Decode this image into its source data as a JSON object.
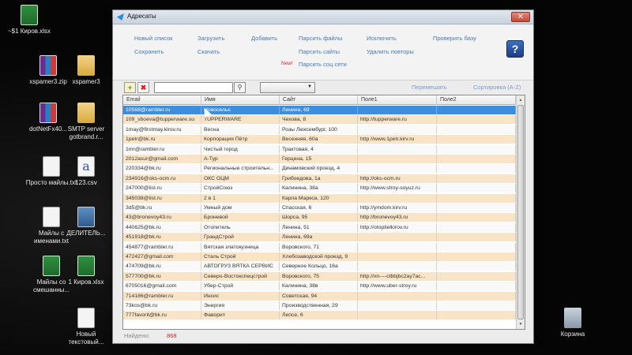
{
  "desktop": {
    "icons": [
      {
        "label": "~$1 Киров.xlsx",
        "icon": "excel-file-icon"
      },
      {
        "label": "xspamer3.zip",
        "icon": "winrar-archive-icon"
      },
      {
        "label": "xspamer3",
        "icon": "folder-icon"
      },
      {
        "label": "dotNetFx40...",
        "icon": "winrar-archive-icon"
      },
      {
        "label": "SMTP server gotbrand.r...",
        "icon": "folder-icon"
      },
      {
        "label": "Просто майлы.txt",
        "icon": "text-file-icon"
      },
      {
        "label": "123.csv",
        "icon": "csv-file-icon"
      },
      {
        "label": "Майлы с именами.txt",
        "icon": "text-file-icon"
      },
      {
        "label": "ДЕЛИТЕЛЬ...",
        "icon": "image-file-icon"
      },
      {
        "label": "Майлы со смешанны...",
        "icon": "excel-file-icon"
      },
      {
        "label": "1 Киров.xlsx",
        "icon": "excel-file-icon"
      },
      {
        "label": "Новый текстовый...",
        "icon": "text-file-icon"
      },
      {
        "label": "Корзина",
        "icon": "recycle-bin-icon"
      }
    ]
  },
  "window": {
    "title": "Адресаты",
    "close_glyph": "✕",
    "help_glyph": "?"
  },
  "toolbar": {
    "new_list": "Новый список",
    "save": "Сохранить",
    "load": "Загрузить",
    "download": "Скачать",
    "add": "Добавить",
    "parse_files": "Парсить файлы",
    "parse_sites": "Парсить сайты",
    "new_badge": "New!",
    "parse_social": "Парсить соц сети",
    "exclude": "Исключить",
    "remove_duplicates": "Удалить повторы",
    "check_base": "Проверить  базу"
  },
  "filterbar": {
    "add_glyph": "+",
    "delete_glyph": "✖",
    "search_value": "",
    "search_glyph": "⚲",
    "combo_value": "",
    "shuffle": "Перемешать",
    "sort": "Сортировка (A-Z)"
  },
  "grid": {
    "columns": [
      "Email",
      "Имя",
      "Сайт",
      "Поле1",
      "Поле2"
    ],
    "selected_row": 0,
    "rows": [
      [
        "10568@rambler.ru",
        "Новосельє",
        "Ленина, 69",
        "",
        ""
      ],
      [
        "109_sboeva@tupperware.su",
        "TUPPERWARE",
        "Чехова, 8",
        "http://tupperware.ru",
        ""
      ],
      [
        "1may@firstmay.kirov.ru",
        "Весна",
        "Розы Люксембург, 100",
        "",
        ""
      ],
      [
        "1petr@bk.ru",
        "Корпорация Пётр",
        "Весенняя, 60а",
        "http://www.1petr.kirv.ru",
        ""
      ],
      [
        "1mr@rambler.ru",
        "Чистый город",
        "Трактовая, 4",
        "",
        ""
      ],
      [
        "2012asur@gmail.com",
        "А-Тур",
        "Герцена, 15",
        "",
        ""
      ],
      [
        "220334@bk.ru",
        "Региональные строительн...",
        "Динамовский проезд, 4",
        "",
        ""
      ],
      [
        "234916@oks-ocm.ru",
        "ОКС ОЦМ",
        "Грибоедова, 1а",
        "http://oks-ocm.ru",
        ""
      ],
      [
        "247000@list.ru",
        "СтройСоюз",
        "Калинина, 38а",
        "http://www.stroy-soyuz.ru",
        ""
      ],
      [
        "345038@list.ru",
        "2 в 1",
        "Карла Маркса, 120",
        "",
        ""
      ],
      [
        "3d5@bk.ru",
        "Умный дом",
        "Спасская, 6",
        "http://ymdom.kirv.ru",
        ""
      ],
      [
        "43@bronevoy43.ru",
        "Броневой",
        "Шорса, 95",
        "http://bronevoy43.ru",
        ""
      ],
      [
        "440625@bk.ru",
        "Отопитель",
        "Ленина, 51",
        "http://otopitelkirov.ru",
        ""
      ],
      [
        "451918@bk.ru",
        "ГрандСтрой",
        "Ленина, 69а",
        "",
        ""
      ],
      [
        "454877@rambler.ru",
        "Вятская златокузница",
        "Воровского, 71",
        "",
        ""
      ],
      [
        "472427@gmail.com",
        "Сталь Строй",
        "Хлебозаводской проезд, 9",
        "",
        ""
      ],
      [
        "474709@bk.ru",
        "АВТОГРУЗ ВЯТКА СЕРВИС",
        "Северное Кольцо, 16а",
        "",
        ""
      ],
      [
        "577700@bk.ru",
        "Северо-Востокспецстрой",
        "Воровского, 75",
        "http://xn----ctbbjbc2ay7ac...",
        ""
      ],
      [
        "6705016@gmail.com",
        "Убер-Строй",
        "Калинина, 38в",
        "http://www.uber-stroy.ru",
        ""
      ],
      [
        "714186@rambler.ru",
        "Инсис",
        "Советская, 94",
        "",
        ""
      ],
      [
        "73kos@bk.ru",
        "Энергия",
        "Производственная, 29",
        "",
        ""
      ],
      [
        "777favorit@bk.ru",
        "Фаворит",
        "Лепсе, 6",
        "",
        ""
      ]
    ]
  },
  "status": {
    "found_label": "Найдено:",
    "found_count": "868"
  }
}
